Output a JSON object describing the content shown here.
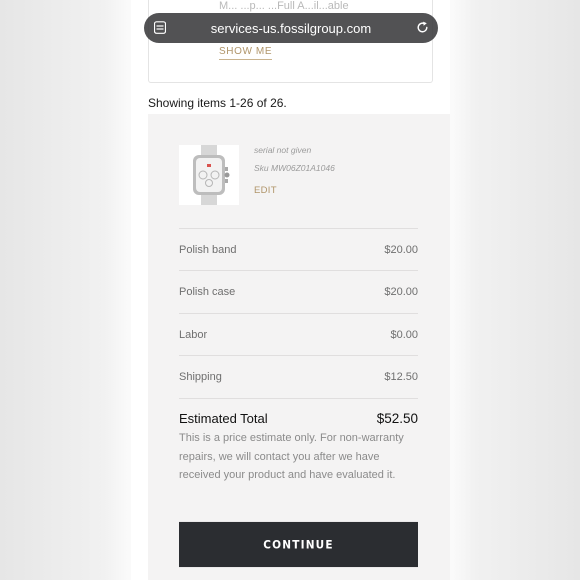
{
  "browser": {
    "url": "services-us.fossilgroup.com"
  },
  "promo_card": {
    "faded_text": "M... ...p... ...Full A...il...able",
    "show_me_label": "SHOW ME"
  },
  "results": {
    "showing_text": "Showing items 1-26 of 26."
  },
  "product": {
    "serial": "serial not given",
    "sku": "Sku MW06Z01A1046",
    "edit_label": "EDIT"
  },
  "line_items": [
    {
      "label": "Polish band",
      "price": "$20.00"
    },
    {
      "label": "Polish case",
      "price": "$20.00"
    },
    {
      "label": "Labor",
      "price": "$0.00"
    },
    {
      "label": "Shipping",
      "price": "$12.50"
    }
  ],
  "total": {
    "label": "Estimated Total",
    "value": "$52.50",
    "disclaimer": "This is a price estimate only. For non-warranty repairs, we will contact you after we have received your product and have evaluated it."
  },
  "actions": {
    "continue_label": "CONTINUE"
  },
  "colors": {
    "accent_gold": "#b0956a",
    "button_dark": "#2b2d31",
    "panel_gray": "#f4f3f3"
  }
}
